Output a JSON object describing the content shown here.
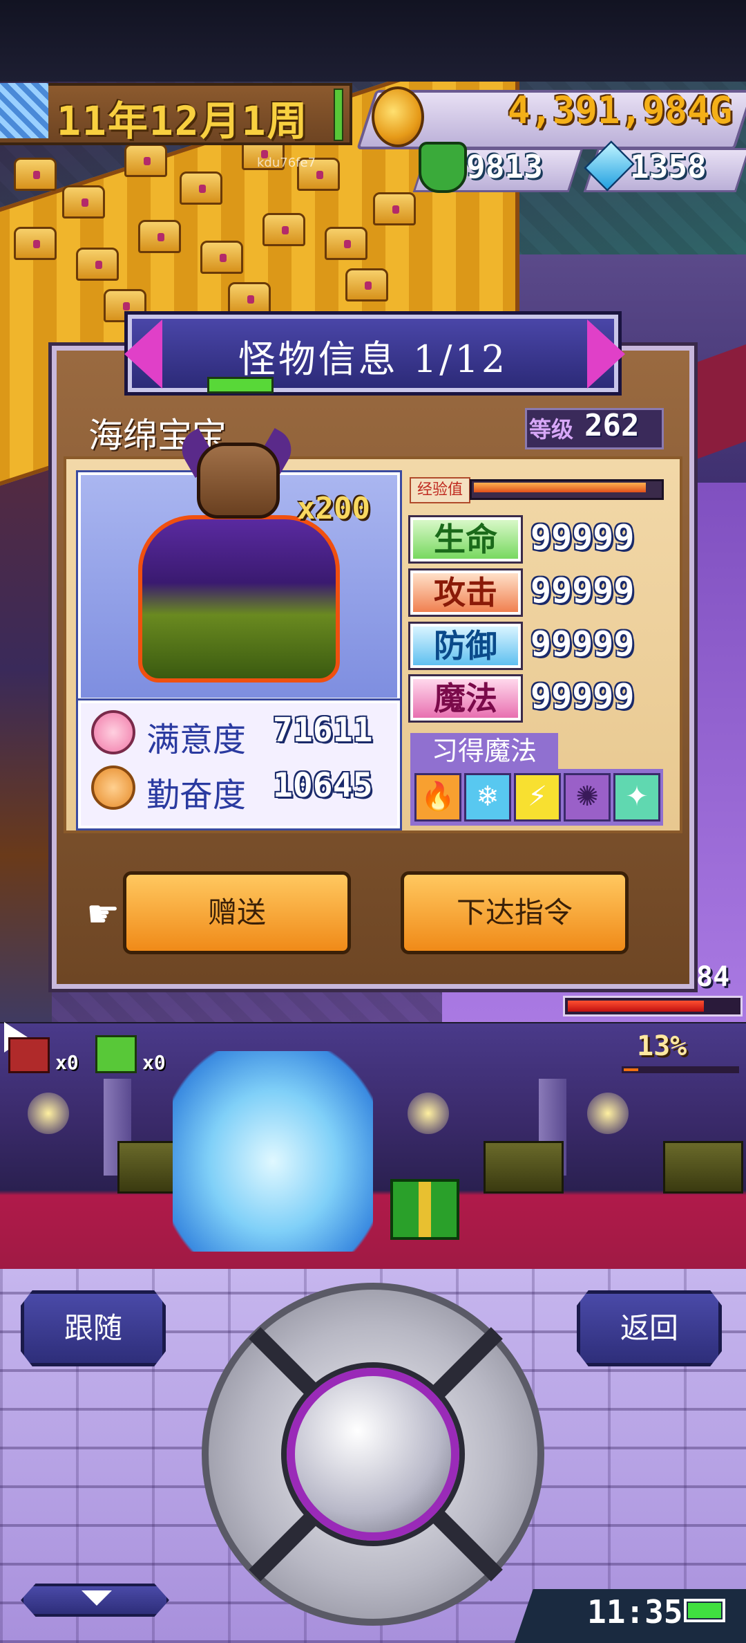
{
  "hud": {
    "date": "11年12月1周",
    "gold": "4,391,984G",
    "population": "9813",
    "gems": "1358",
    "overlay_id": "kdu76fe7"
  },
  "dialog": {
    "title": "怪物信息 1/12",
    "monster_name": "海绵宝宝",
    "level_label": "等级",
    "level_value": "262",
    "multiplier": "x200",
    "exp_label": "经验值",
    "exp_fraction": 0.95,
    "stats": {
      "hp_label": "生命",
      "hp": "99999",
      "atk_label": "攻击",
      "atk": "99999",
      "def_label": "防御",
      "def": "99999",
      "mag_label": "魔法",
      "mag": "99999"
    },
    "satisfaction_label": "满意度",
    "satisfaction_value": "71611",
    "diligence_label": "勤奋度",
    "diligence_value": "10645",
    "magic_label": "习得魔法",
    "magic_icons": [
      "fire-magic-icon",
      "ice-magic-icon",
      "lightning-magic-icon",
      "wind-magic-icon",
      "heal-magic-icon"
    ],
    "gift_button": "赠送",
    "order_button": "下达指令"
  },
  "battle": {
    "side_badge": "84",
    "bag_count": "x0",
    "gift_count": "x0",
    "progress_percent": "13%",
    "progress_fraction": 0.13,
    "hp_fraction": 0.8
  },
  "controls": {
    "follow_button": "跟随",
    "back_button": "返回",
    "clock": "11:35"
  },
  "colors": {
    "accent": "#9a2ab8",
    "panel_brown": "#9a6a40",
    "button_orange": "#f08a18",
    "button_blue": "#2e2e7a"
  }
}
